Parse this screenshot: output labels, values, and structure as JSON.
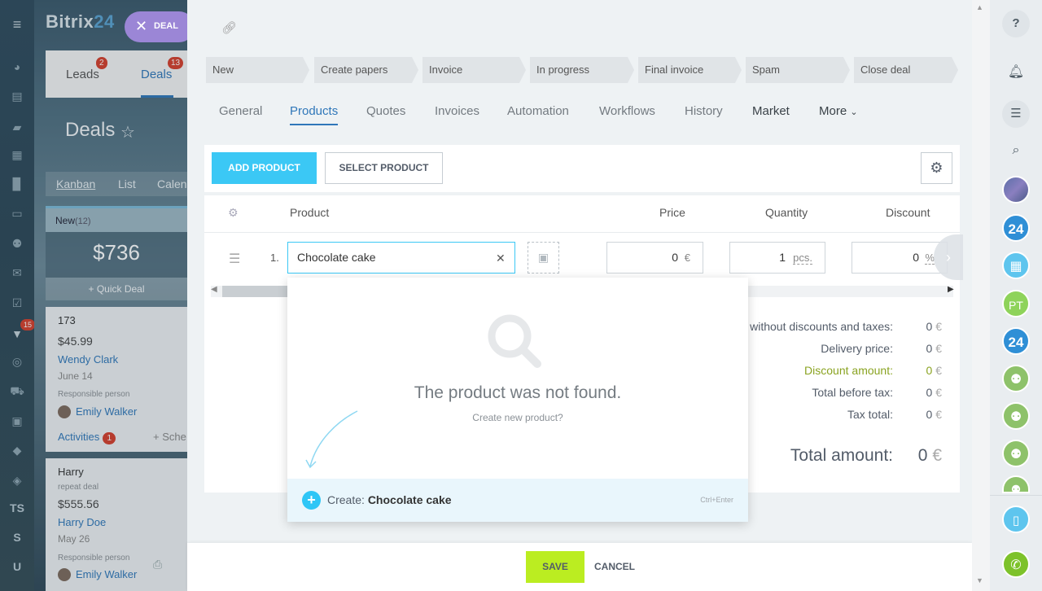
{
  "app": {
    "logo_main": "Bitrix",
    "logo_num": "24"
  },
  "deal_pill": {
    "label": "DEAL"
  },
  "crm_tabs": [
    {
      "label": "Leads",
      "badge": "2"
    },
    {
      "label": "Deals",
      "badge": "13"
    }
  ],
  "crm": {
    "title": "Deals",
    "views": [
      "Kanban",
      "List",
      "Calen"
    ],
    "stage": {
      "name": "New",
      "count": "(12)",
      "sum": "$736",
      "quick": "+ Quick Deal"
    },
    "cards": [
      {
        "title": "173",
        "price": "$45.99",
        "contact": "Wendy Clark",
        "date": "June 14",
        "resp_label": "Responsible person",
        "owner": "Emily Walker",
        "activities": "Activities",
        "act_count": "1",
        "schedule": "+ Sche"
      },
      {
        "title": "Harry",
        "sub": "repeat deal",
        "price": "$555.56",
        "contact": "Harry Doe",
        "date": "May 26",
        "resp_label": "Responsible person",
        "owner": "Emily Walker"
      }
    ]
  },
  "left_rail": {
    "badge": "15",
    "text_items": [
      "TS",
      "S",
      "U"
    ]
  },
  "pipeline": [
    "New",
    "Create papers",
    "Invoice",
    "In progress",
    "Final invoice",
    "Spam",
    "Close deal"
  ],
  "entity_tabs": [
    "General",
    "Products",
    "Quotes",
    "Invoices",
    "Automation",
    "Workflows",
    "History",
    "Market",
    "More"
  ],
  "toolbar": {
    "add_label": "ADD PRODUCT",
    "select_label": "SELECT PRODUCT"
  },
  "grid": {
    "headers": {
      "product": "Product",
      "price": "Price",
      "quantity": "Quantity",
      "discount": "Discount"
    },
    "row": {
      "num": "1.",
      "product": "Chocolate cake",
      "price": "0",
      "currency": "€",
      "qty": "1",
      "unit": "pcs.",
      "discount": "0",
      "disc_unit": "%"
    }
  },
  "totals": [
    {
      "label": "without discounts and taxes:",
      "value": "0",
      "cur": "€"
    },
    {
      "label": "Delivery price:",
      "value": "0",
      "cur": "€"
    },
    {
      "label": "Discount amount:",
      "value": "0",
      "cur": "€"
    },
    {
      "label": "Total before tax:",
      "value": "0",
      "cur": "€"
    },
    {
      "label": "Tax total:",
      "value": "0",
      "cur": "€"
    }
  ],
  "total_amount": {
    "label": "Total amount:",
    "value": "0",
    "cur": "€"
  },
  "dropdown": {
    "message": "The product was not found.",
    "link": "Create new product?",
    "create_prefix": "Create:",
    "create_name": "Chocolate cake",
    "hint": "Ctrl+Enter"
  },
  "footer": {
    "save": "SAVE",
    "cancel": "CANCEL"
  },
  "right_rail": {
    "av_24": "24",
    "av_pt": "PT"
  },
  "colors": {
    "accent": "#3bc8f5",
    "save": "#bbed21",
    "link": "#2f77b9",
    "badge": "#d63d2a",
    "discount": "#8aa321"
  }
}
